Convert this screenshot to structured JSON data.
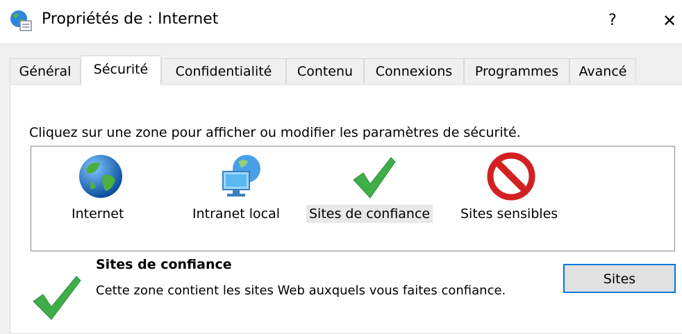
{
  "window": {
    "title": "Propriétés de : Internet",
    "help_label": "?",
    "close_label": "✕"
  },
  "tabs": [
    {
      "label": "Général"
    },
    {
      "label": "Sécurité",
      "active": true
    },
    {
      "label": "Confidentialité"
    },
    {
      "label": "Contenu"
    },
    {
      "label": "Connexions"
    },
    {
      "label": "Programmes"
    },
    {
      "label": "Avancé"
    }
  ],
  "security": {
    "instruction": "Cliquez sur une zone pour afficher ou modifier les paramètres de sécurité.",
    "zones": [
      {
        "label": "Internet",
        "icon": "globe-icon"
      },
      {
        "label": "Intranet local",
        "icon": "intranet-icon"
      },
      {
        "label": "Sites de confiance",
        "icon": "checkmark-icon",
        "selected": true
      },
      {
        "label": "Sites sensibles",
        "icon": "prohibited-icon"
      }
    ],
    "selected_zone": {
      "title": "Sites de confiance",
      "description": "Cette zone contient les sites Web auxquels vous faites confiance."
    },
    "sites_button_label": "Sites"
  },
  "colors": {
    "accent": "#0078d7",
    "check_green": "#3fae49",
    "prohibited_red": "#d32020",
    "globe_blue": "#1f6fc0"
  }
}
